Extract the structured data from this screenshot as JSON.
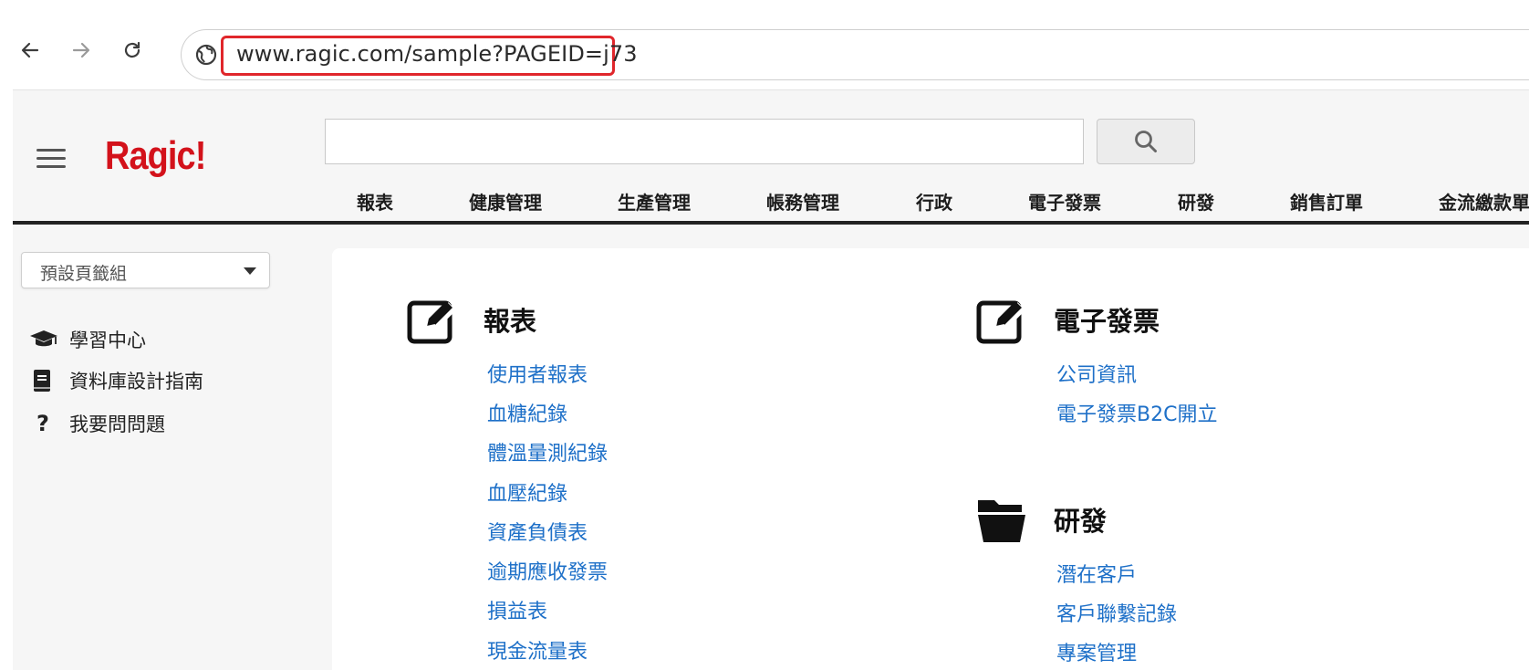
{
  "browser": {
    "url": "www.ragic.com/sample?PAGEID=j73",
    "back_icon": "back-arrow-icon",
    "forward_icon": "forward-arrow-icon",
    "reload_icon": "reload-icon"
  },
  "app": {
    "logo": "Ragic!",
    "logo_color": "#d3121b",
    "search_placeholder": "",
    "tabs": [
      "報表",
      "健康管理",
      "生產管理",
      "帳務管理",
      "行政",
      "電子發票",
      "研發",
      "銷售訂單",
      "金流繳款單"
    ]
  },
  "sidebar": {
    "tabset_select": "預設頁籤組",
    "links": [
      {
        "label": "學習中心",
        "icon": "graduation-cap-icon"
      },
      {
        "label": "資料庫設計指南",
        "icon": "book-icon"
      },
      {
        "label": "我要問問題",
        "icon": "question-icon"
      }
    ]
  },
  "sections": [
    {
      "title": "報表",
      "icon": "edit-icon",
      "links": [
        "使用者報表",
        "血糖紀錄",
        "體溫量測紀錄",
        "血壓紀錄",
        "資產負債表",
        "逾期應收發票",
        "損益表",
        "現金流量表"
      ]
    },
    {
      "title": "電子發票",
      "icon": "edit-icon",
      "links": [
        "公司資訊",
        "電子發票B2C開立"
      ]
    },
    {
      "title": "研發",
      "icon": "folder-open-icon",
      "links": [
        "潛在客戶",
        "客戶聯繫記錄",
        "專案管理"
      ]
    }
  ],
  "colors": {
    "link": "#1e70c8",
    "highlight": "#e0262b"
  }
}
